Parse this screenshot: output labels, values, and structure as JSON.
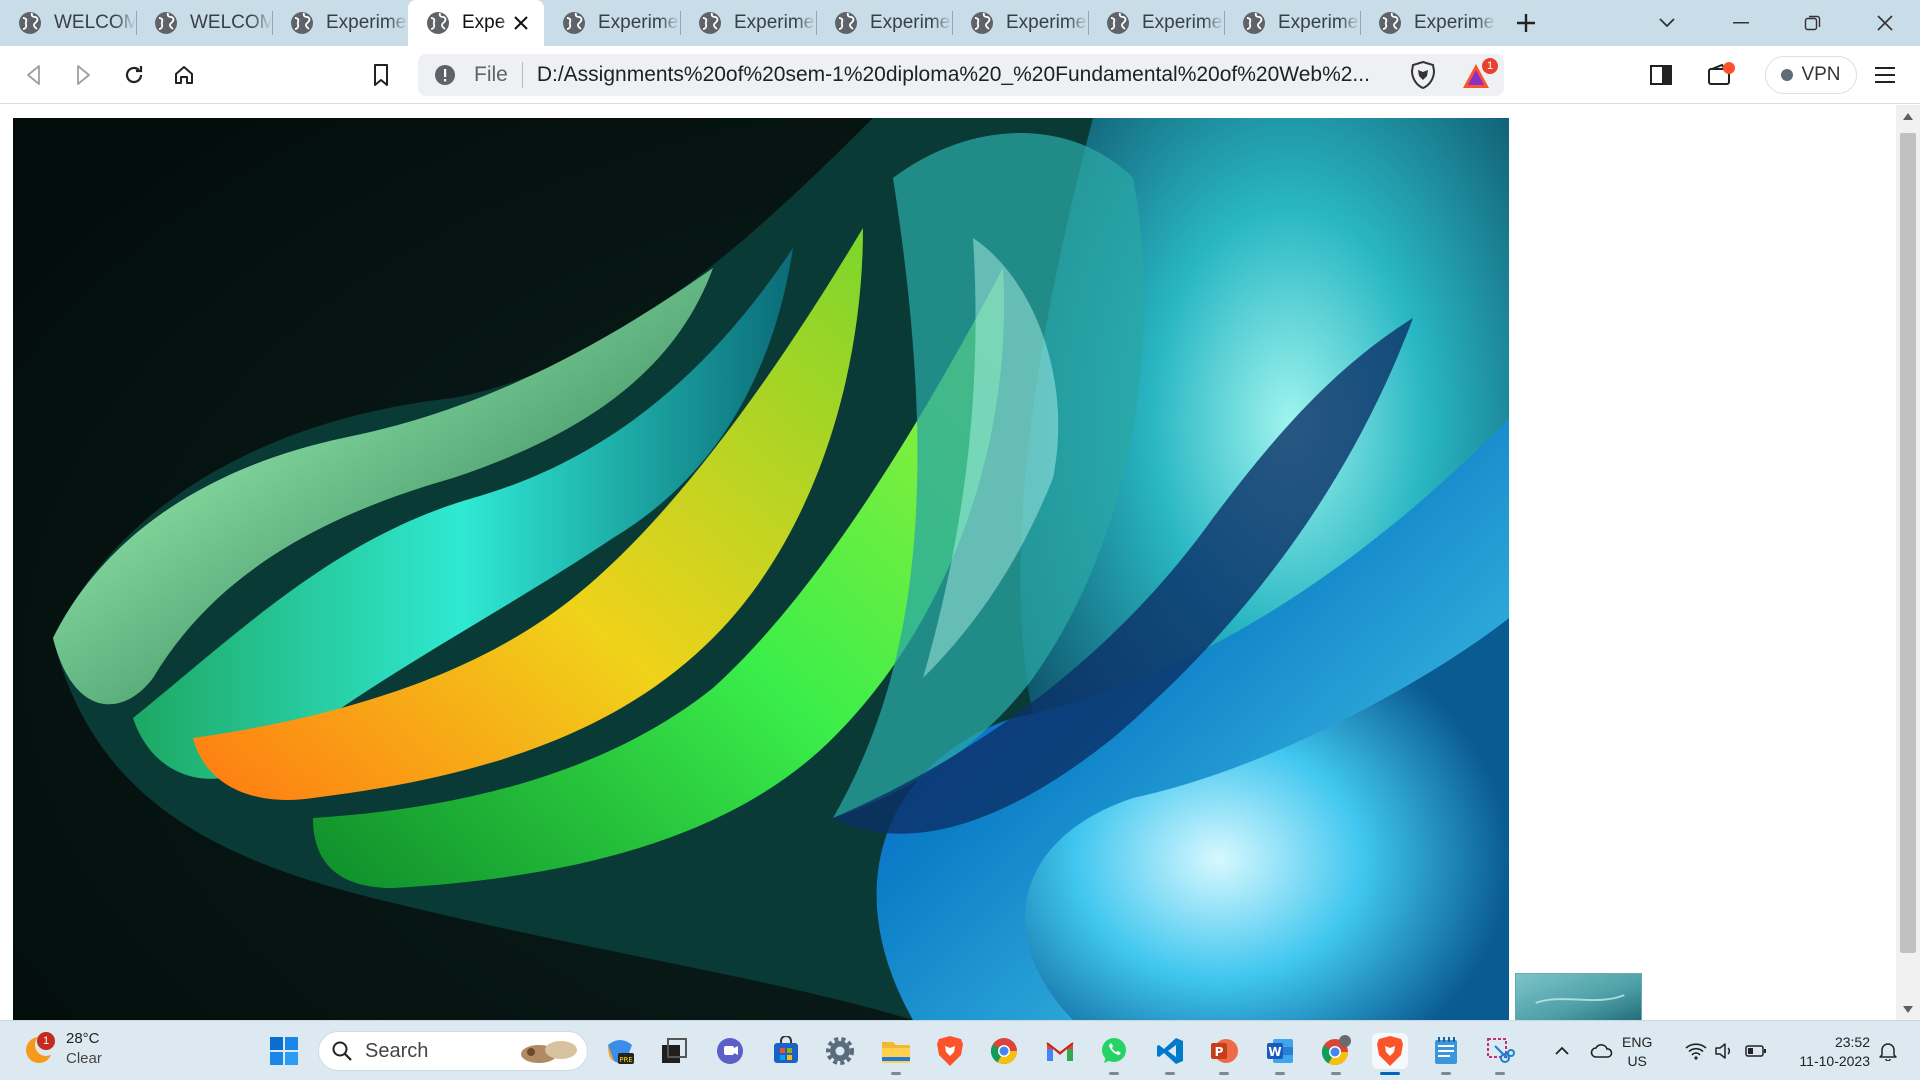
{
  "browser": {
    "tabs": [
      {
        "label": "WELCOM",
        "active": false
      },
      {
        "label": "WELCOM",
        "active": false
      },
      {
        "label": "Experime",
        "active": false
      },
      {
        "label": "Expe",
        "active": true
      },
      {
        "label": "Experime",
        "active": false
      },
      {
        "label": "Experime",
        "active": false
      },
      {
        "label": "Experime",
        "active": false
      },
      {
        "label": "Experime",
        "active": false
      },
      {
        "label": "Experime",
        "active": false
      },
      {
        "label": "Experime",
        "active": false
      },
      {
        "label": "Experime",
        "active": false
      }
    ],
    "address": {
      "scheme_label": "File",
      "url": "D:/Assignments%20of%20sem-1%20diploma%20_%20Fundamental%20of%20Web%2..."
    },
    "shield_badge_count": "1",
    "vpn_label": "VPN",
    "colors": {
      "tab_strip": "#c9dde8",
      "omnibox": "#eef0f3",
      "brave_orange": "#fb542b"
    }
  },
  "taskbar": {
    "weather": {
      "temp": "28°C",
      "condition": "Clear",
      "badge": "1"
    },
    "search_label": "Search",
    "language": {
      "line1": "ENG",
      "line2": "US"
    },
    "clock": {
      "time": "23:52",
      "date": "11-10-2023"
    }
  }
}
